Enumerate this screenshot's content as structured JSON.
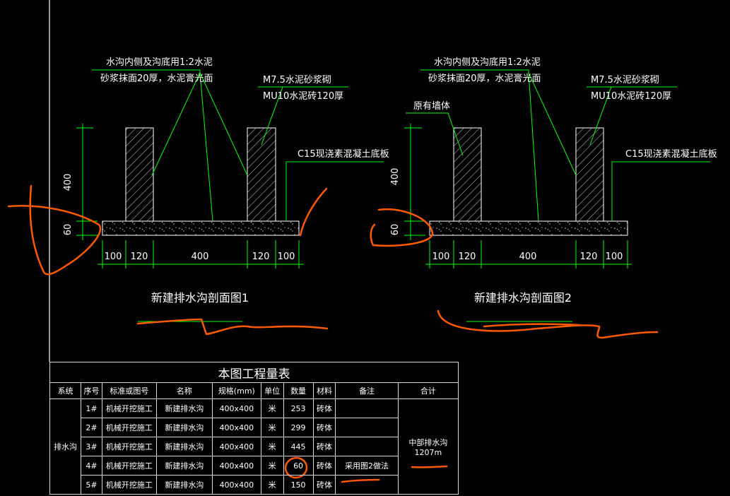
{
  "drawing1": {
    "title": "新建排水沟剖面图1",
    "note_lining_1": "水沟内侧及沟底用1:2水泥",
    "note_lining_2": "砂浆抹面20厚，水泥膏光面",
    "note_wall_1": "M7.5水泥砂浆砌",
    "note_wall_2": "MU10水泥砖120厚",
    "note_base": "C15现浇素混凝土底板",
    "dim_height_wall": "400",
    "dim_height_base": "60",
    "dims_bottom": [
      "100",
      "120",
      "400",
      "120",
      "100"
    ]
  },
  "drawing2": {
    "title": "新建排水沟剖面图2",
    "note_lining_1": "水沟内侧及沟底用1:2水泥",
    "note_lining_2": "砂浆抹面20厚，水泥膏光面",
    "note_wall_1": "M7.5水泥砂浆砌",
    "note_wall_2": "MU10水泥砖120厚",
    "note_existing": "原有墙体",
    "note_base": "C15现浇素混凝土底板",
    "dim_height_wall": "400",
    "dim_height_base": "60",
    "dims_bottom": [
      "100",
      "120",
      "400",
      "120",
      "100"
    ]
  },
  "table": {
    "title": "本图工程量表",
    "headers": [
      "系统",
      "序号",
      "标准或图号",
      "名称",
      "规格(mm)",
      "单位",
      "数量",
      "材料",
      "备注",
      "合计"
    ],
    "system": "排水沟",
    "rows": [
      {
        "no": "1#",
        "std": "机械开挖施工",
        "name": "新建排水沟",
        "spec": "400x400",
        "unit": "米",
        "qty": "253",
        "mat": "砖体",
        "note": ""
      },
      {
        "no": "2#",
        "std": "机械开挖施工",
        "name": "新建排水沟",
        "spec": "400x400",
        "unit": "米",
        "qty": "299",
        "mat": "砖体",
        "note": ""
      },
      {
        "no": "3#",
        "std": "机械开挖施工",
        "name": "新建排水沟",
        "spec": "400x400",
        "unit": "米",
        "qty": "445",
        "mat": "砖体",
        "note": ""
      },
      {
        "no": "4#",
        "std": "机械开挖施工",
        "name": "新建排水沟",
        "spec": "400x400",
        "unit": "米",
        "qty": "60",
        "mat": "砖体",
        "note": "采用图2做法"
      },
      {
        "no": "5#",
        "std": "机械开挖施工",
        "name": "新建排水沟",
        "spec": "400x400",
        "unit": "米",
        "qty": "150",
        "mat": "砖体",
        "note": ""
      }
    ],
    "total_1": "中部排水沟",
    "total_2": "1207m"
  },
  "colors": {
    "background": "#000000",
    "leader": "#00ff00",
    "line": "#ffffff",
    "markup": "#ff5a00"
  }
}
